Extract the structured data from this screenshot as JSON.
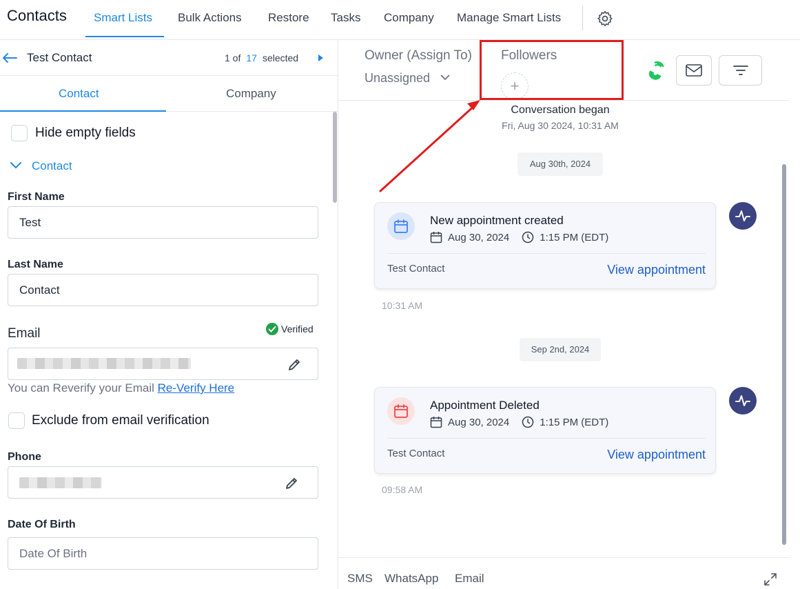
{
  "nav": {
    "title": "Contacts",
    "items": [
      "Smart Lists",
      "Bulk Actions",
      "Restore",
      "Tasks",
      "Company",
      "Manage Smart Lists"
    ],
    "active": "Smart Lists"
  },
  "contact_header": {
    "name": "Test Contact",
    "pager_prefix": "1 of",
    "pager_total": "17",
    "pager_suffix": "selected"
  },
  "subtabs": [
    "Contact",
    "Company"
  ],
  "hide_empty_fields": "Hide empty fields",
  "section_title": "Contact",
  "fields": {
    "first_name": {
      "label": "First Name",
      "value": "Test"
    },
    "last_name": {
      "label": "Last Name",
      "value": "Contact"
    },
    "email": {
      "label": "Email",
      "verified_label": "Verified"
    },
    "reverify_text": "You can Reverify your Email",
    "reverify_link": "Re-Verify Here",
    "exclude_verification": "Exclude from email verification",
    "phone": {
      "label": "Phone"
    },
    "dob": {
      "label": "Date Of Birth",
      "placeholder": "Date Of Birth"
    }
  },
  "right_header": {
    "owner_label": "Owner (Assign To)",
    "owner_value": "Unassigned",
    "followers_label": "Followers",
    "add_symbol": "+"
  },
  "feed": {
    "conversation_began": "Conversation began",
    "conversation_time": "Fri, Aug 30 2024, 10:31 AM",
    "groups": [
      {
        "date": "Aug 30th, 2024",
        "title": "New appointment created",
        "date_value": "Aug 30, 2024",
        "time_value": "1:15 PM (EDT)",
        "contact": "Test Contact",
        "link": "View appointment",
        "timestamp": "10:31 AM",
        "icon_color": "#3b82f6"
      },
      {
        "date": "Sep 2nd, 2024",
        "title": "Appointment Deleted",
        "date_value": "Aug 30, 2024",
        "time_value": "1:15 PM (EDT)",
        "contact": "Test Contact",
        "link": "View appointment",
        "timestamp": "09:58 AM",
        "icon_color": "#ef4444"
      }
    ]
  },
  "compose_tabs": [
    "SMS",
    "WhatsApp",
    "Email"
  ],
  "colors": {
    "accent": "#1e88e5",
    "highlight": "#e11d1d",
    "phone": "#22c55e",
    "activity": "#3b4380"
  }
}
